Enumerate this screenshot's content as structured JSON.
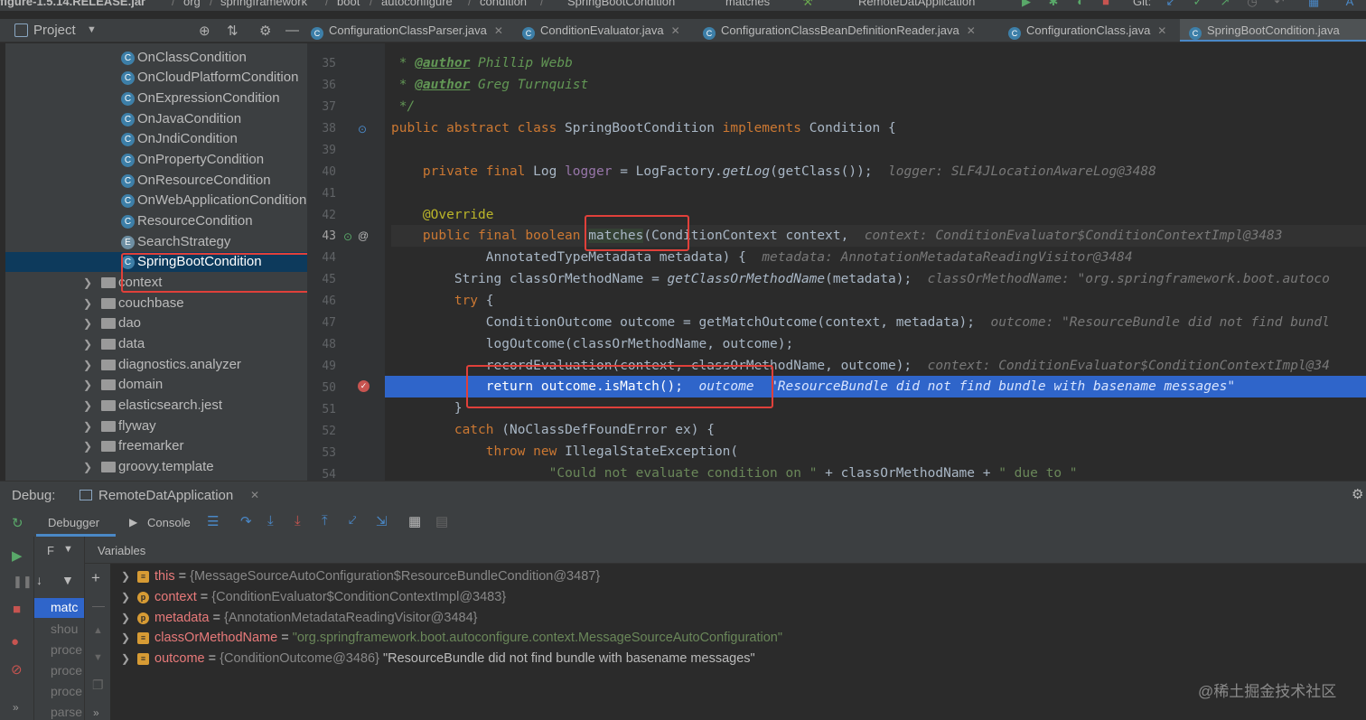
{
  "breadcrumbs": [
    "figure-1.5.14.RELEASE.jar",
    "org",
    "springframework",
    "boot",
    "autoconfigure",
    "condition",
    "SpringBootCondition",
    "matches"
  ],
  "run_config": "RemoteDatApplication",
  "git_label": "Git:",
  "project_panel": {
    "title": "Project"
  },
  "tabs": [
    {
      "label": "ConfigurationClassParser.java",
      "active": false
    },
    {
      "label": "ConditionEvaluator.java",
      "active": false
    },
    {
      "label": "ConfigurationClassBeanDefinitionReader.java",
      "active": false
    },
    {
      "label": "ConfigurationClass.java",
      "active": false
    },
    {
      "label": "SpringBootCondition.java",
      "active": true
    }
  ],
  "tree": {
    "classes": [
      "OnClassCondition",
      "OnCloudPlatformCondition",
      "OnExpressionCondition",
      "OnJavaCondition",
      "OnJndiCondition",
      "OnPropertyCondition",
      "OnResourceCondition",
      "OnWebApplicationCondition",
      "ResourceCondition",
      "SearchStrategy",
      "SpringBootCondition"
    ],
    "selected": "SpringBootCondition",
    "folders": [
      "context",
      "couchbase",
      "dao",
      "data",
      "diagnostics.analyzer",
      "domain",
      "elasticsearch.jest",
      "flyway",
      "freemarker",
      "groovy.template"
    ]
  },
  "editor": {
    "line_numbers": [
      "35",
      "36",
      "37",
      "38",
      "39",
      "40",
      "41",
      "42",
      "43",
      "44",
      "45",
      "46",
      "47",
      "48",
      "49",
      "50",
      "51",
      "52",
      "53",
      "54"
    ],
    "author1": "Phillip Webb",
    "author2": "Greg Turnquist",
    "inlay_logger": "logger: SLF4JLocationAwareLog@3488",
    "inlay_context": "context: ConditionEvaluator$ConditionContextImpl@3483",
    "inlay_metadata": "metadata: AnnotationMetadataReadingVisitor@3484",
    "inlay_classname": "classOrMethodName: \"org.springframework.boot.autoco",
    "inlay_outcome": "outcome: \"ResourceBundle did not find bundl",
    "inlay_context2": "context: ConditionEvaluator$ConditionContextImpl@34",
    "inlay_return_key": "outcome",
    "inlay_return_val": "\"ResourceBundle did not find bundle with basename messages\"",
    "string_line54": "\"Could not evaluate condition on \"",
    "string_line54b": "\" due to \""
  },
  "debug": {
    "label": "Debug:",
    "session": "RemoteDatApplication",
    "tab_debugger": "Debugger",
    "tab_console": "Console",
    "frames_header": "F",
    "variables_header": "Variables",
    "frames": [
      "matc",
      "shou",
      "proce",
      "proce",
      "proce",
      "parse"
    ],
    "variables": [
      {
        "name": "this",
        "ref": "{MessageSourceAutoConfiguration$ResourceBundleCondition@3487}",
        "icon": "field"
      },
      {
        "name": "context",
        "ref": "{ConditionEvaluator$ConditionContextImpl@3483}",
        "icon": "param"
      },
      {
        "name": "metadata",
        "ref": "{AnnotationMetadataReadingVisitor@3484}",
        "icon": "param"
      },
      {
        "name": "classOrMethodName",
        "str": "\"org.springframework.boot.autoconfigure.context.MessageSourceAutoConfiguration\"",
        "icon": "field"
      },
      {
        "name": "outcome",
        "ref": "{ConditionOutcome@3486}",
        "str": "\"ResourceBundle did not find bundle with basename messages\"",
        "icon": "field"
      }
    ]
  },
  "watermark": "@稀土掘金技术社区",
  "colors": {
    "accent": "#4a88c7",
    "highlight": "#2f65ca",
    "annotation_box": "#e0403a"
  }
}
